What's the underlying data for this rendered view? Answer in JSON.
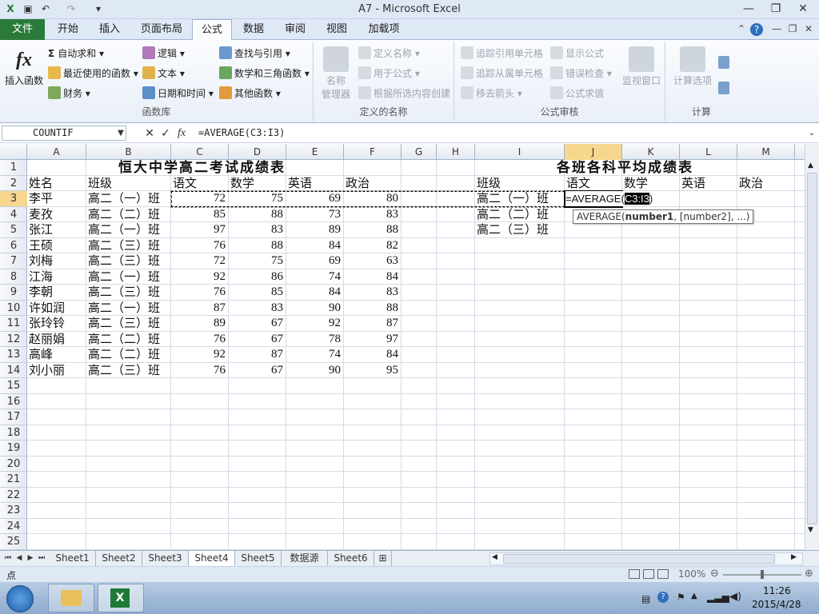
{
  "window": {
    "title": "A7  -  Microsoft Excel"
  },
  "tabs": {
    "file": "文件",
    "items": [
      "开始",
      "插入",
      "页面布局",
      "公式",
      "数据",
      "审阅",
      "视图",
      "加载项"
    ],
    "active": "公式"
  },
  "ribbon": {
    "insert_function": "插入函数",
    "autosum": "自动求和",
    "recent": "最近使用的函数",
    "financial": "财务",
    "logical": "逻辑",
    "text": "文本",
    "datetime": "日期和时间",
    "lookup": "查找与引用",
    "math": "数学和三角函数",
    "more": "其他函数",
    "group_library": "函数库",
    "name_manager_1": "名称",
    "name_manager_2": "管理器",
    "define_name": "定义名称",
    "use_in_formula": "用于公式",
    "create_from_selection": "根据所选内容创建",
    "group_names": "定义的名称",
    "trace_precedents": "追踪引用单元格",
    "trace_dependents": "追踪从属单元格",
    "remove_arrows": "移去箭头",
    "show_formulas": "显示公式",
    "error_checking": "错误检查",
    "evaluate_formula": "公式求值",
    "group_audit": "公式审核",
    "watch_window": "监视窗口",
    "calc_options": "计算选项",
    "group_calc": "计算"
  },
  "formula_bar": {
    "name_box": "COUNTIF",
    "fx": "fx",
    "formula": "=AVERAGE(C3:I3)"
  },
  "columns": [
    "A",
    "B",
    "C",
    "D",
    "E",
    "F",
    "G",
    "H",
    "I",
    "J",
    "K",
    "L",
    "M"
  ],
  "active_column": "J",
  "active_row": 3,
  "rows": [
    "1",
    "2",
    "3",
    "4",
    "5",
    "6",
    "7",
    "8",
    "9",
    "10",
    "11",
    "12",
    "13",
    "14",
    "15",
    "16",
    "17",
    "18",
    "19",
    "20",
    "21",
    "22",
    "23",
    "24",
    "25"
  ],
  "sheet": {
    "title_left": "恒大中学高二考试成绩表",
    "title_right": "各班各科平均成绩表",
    "headers": [
      "姓名",
      "班级",
      "语文",
      "数学",
      "英语",
      "政治"
    ],
    "records": [
      [
        "李平",
        "高二（一）班",
        "72",
        "75",
        "69",
        "80"
      ],
      [
        "麦孜",
        "高二（二）班",
        "85",
        "88",
        "73",
        "83"
      ],
      [
        "张江",
        "高二（一）班",
        "97",
        "83",
        "89",
        "88"
      ],
      [
        "王硕",
        "高二（三）班",
        "76",
        "88",
        "84",
        "82"
      ],
      [
        "刘梅",
        "高二（三）班",
        "72",
        "75",
        "69",
        "63"
      ],
      [
        "江海",
        "高二（一）班",
        "92",
        "86",
        "74",
        "84"
      ],
      [
        "李朝",
        "高二（三）班",
        "76",
        "85",
        "84",
        "83"
      ],
      [
        "许如润",
        "高二（一）班",
        "87",
        "83",
        "90",
        "88"
      ],
      [
        "张玲铃",
        "高二（三）班",
        "89",
        "67",
        "92",
        "87"
      ],
      [
        "赵丽娟",
        "高二（二）班",
        "76",
        "67",
        "78",
        "97"
      ],
      [
        "高峰",
        "高二（二）班",
        "92",
        "87",
        "74",
        "84"
      ],
      [
        "刘小丽",
        "高二（三）班",
        "76",
        "67",
        "90",
        "95"
      ]
    ],
    "avg_headers": [
      "班级",
      "语文",
      "数学",
      "英语",
      "政治"
    ],
    "avg_classes": [
      "高二（一）班",
      "高二（二）班",
      "高二（三）班"
    ],
    "editing_prefix": "=AVERAGE(",
    "editing_ref": "C3:I3",
    "editing_suffix": ")",
    "tooltip_fn": "AVERAGE(",
    "tooltip_arg1": "number1",
    "tooltip_rest": ", [number2], ...)"
  },
  "sheet_tabs": [
    "Sheet1",
    "Sheet2",
    "Sheet3",
    "Sheet4",
    "Sheet5",
    "数据源",
    "Sheet6"
  ],
  "active_sheet": "Sheet4",
  "status": {
    "mode": "点",
    "zoom": "100%"
  },
  "taskbar": {
    "time": "11:26",
    "date": "2015/4/28"
  }
}
